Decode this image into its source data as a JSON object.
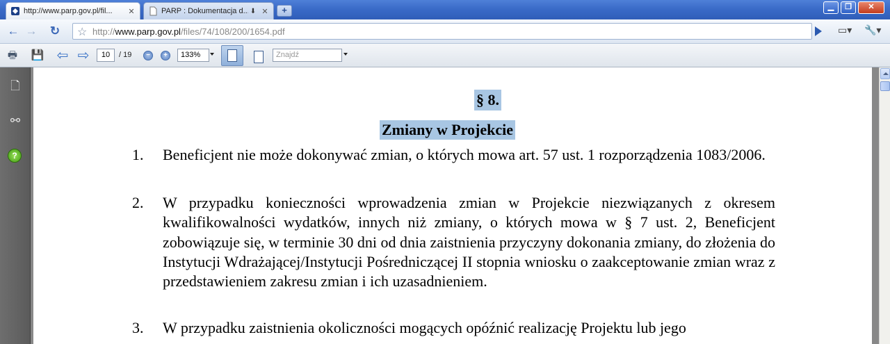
{
  "tabs": [
    {
      "title": "http://www.parp.gov.pl/fil...",
      "close": "✕"
    },
    {
      "title": "PARP : Dokumentacja d...",
      "close": "✕"
    }
  ],
  "new_tab": "+",
  "window_buttons": {
    "minimize": "▁",
    "maximize": "❐",
    "close": "✕"
  },
  "address": {
    "scheme": "http://",
    "host": "www.parp.gov.pl",
    "path": "/files/74/108/200/1654.pdf"
  },
  "pdf_toolbar": {
    "page_current": "10",
    "page_total": "/ 19",
    "zoom": "133%",
    "find_placeholder": "Znajdź"
  },
  "document": {
    "section_number": "§ 8.",
    "section_title": "Zmiany w Projekcie",
    "items": [
      {
        "num": "1.",
        "text": "Beneficjent nie może dokonywać zmian, o których mowa art. 57 ust. 1 rozporządzenia 1083/2006."
      },
      {
        "num": "2.",
        "text": "W przypadku konieczności wprowadzenia zmian w Projekcie niezwiązanych z okresem kwalifikowalności wydatków, innych niż zmiany, o których mowa w § 7 ust. 2, Beneficjent zobowiązuje się, w terminie 30 dni od dnia zaistnienia przyczyny dokonania zmiany, do złożenia do Instytucji Wdrażającej/Instytucji Pośredniczącej II stopnia wniosku o zaakceptowanie zmian wraz z przedstawieniem zakresu zmian i ich uzasadnieniem."
      },
      {
        "num": "3.",
        "text": "W przypadku zaistnienia okoliczności mogących opóźnić realizację Projektu lub jego"
      }
    ]
  },
  "colors": {
    "selection_highlight": "#a8c6e3",
    "left_panel": "#666666",
    "tab_strip": "#3a6bc8"
  }
}
